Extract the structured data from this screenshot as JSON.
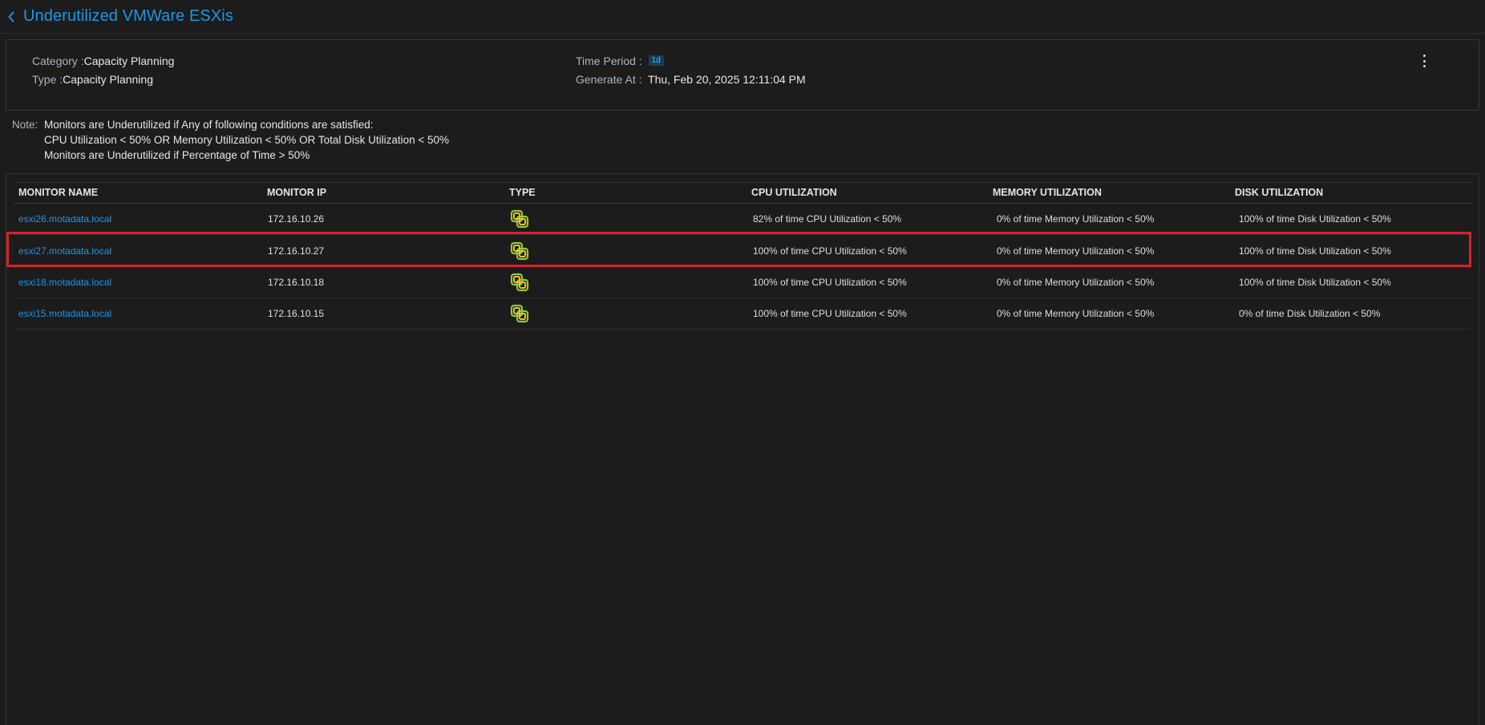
{
  "header": {
    "title": "Underutilized VMWare ESXis"
  },
  "info": {
    "category_label": "Category :",
    "category_value": "Capacity Planning",
    "type_label": "Type :",
    "type_value": "Capacity Planning",
    "time_period_label": "Time Period :",
    "time_period_value": "1d",
    "generate_label": "Generate At :",
    "generate_value": "Thu, Feb 20, 2025 12:11:04 PM"
  },
  "note": {
    "label": "Note:",
    "lines": [
      "Monitors are Underutilized if Any of following conditions are satisfied:",
      "CPU Utilization < 50% OR Memory Utilization < 50% OR Total Disk Utilization < 50%",
      "Monitors are Underutilized if Percentage of Time > 50%"
    ]
  },
  "table": {
    "columns": [
      "MONITOR NAME",
      "MONITOR IP",
      "TYPE",
      "CPU UTILIZATION",
      "MEMORY UTILIZATION",
      "DISK UTILIZATION"
    ],
    "rows": [
      {
        "name": "esxi26.motadata.local",
        "ip": "172.16.10.26",
        "type_icon": "vmware-icon",
        "cpu": "82% of time CPU Utilization < 50%",
        "memory": "0% of time Memory Utilization < 50%",
        "disk": "100% of time Disk Utilization < 50%"
      },
      {
        "name": "esxi27.motadata.local",
        "ip": "172.16.10.27",
        "type_icon": "vmware-icon",
        "cpu": "100% of time CPU Utilization < 50%",
        "memory": "0% of time Memory Utilization < 50%",
        "disk": "100% of time Disk Utilization < 50%"
      },
      {
        "name": "esxi18.motadata.local",
        "ip": "172.16.10.18",
        "type_icon": "vmware-icon",
        "cpu": "100% of time CPU Utilization < 50%",
        "memory": "0% of time Memory Utilization < 50%",
        "disk": "100% of time Disk Utilization < 50%"
      },
      {
        "name": "esxi15.motadata.local",
        "ip": "172.16.10.15",
        "type_icon": "vmware-icon",
        "cpu": "100% of time CPU Utilization < 50%",
        "memory": "0% of time Memory Utilization < 50%",
        "disk": "0% of time Disk Utilization < 50%"
      }
    ],
    "highlighted_row": 1
  },
  "colors": {
    "accent": "#1d95e6",
    "highlight": "#dc1f2a",
    "background": "#1c1c1c"
  }
}
